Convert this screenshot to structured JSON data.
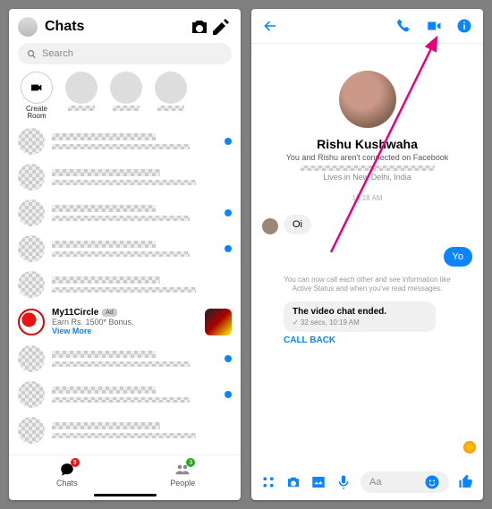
{
  "left": {
    "title": "Chats",
    "search_placeholder": "Search",
    "create_room_label": "Create Room",
    "ad": {
      "name": "My11Circle",
      "badge": "Ad",
      "sub": "Earn Rs. 1500* Bonus.",
      "link": "View More"
    },
    "tabs": {
      "chats": "Chats",
      "chats_badge": "9",
      "people": "People",
      "people_badge": "3"
    }
  },
  "right": {
    "name": "Rishu Kushwaha",
    "sub1": "You and Rishu aren't connected on Facebook",
    "sub2": "Lives in New Delhi, India",
    "timestamp": "10:18 AM",
    "msg_in": "Oi",
    "msg_out": "Yo",
    "info_note": "You can now call each other and see information like Active Status and when you've read messages.",
    "sys_title": "The video chat ended.",
    "sys_sub": "✓ 32 secs, 10:19 AM",
    "callback": "CALL BACK",
    "input_placeholder": "Aa"
  }
}
